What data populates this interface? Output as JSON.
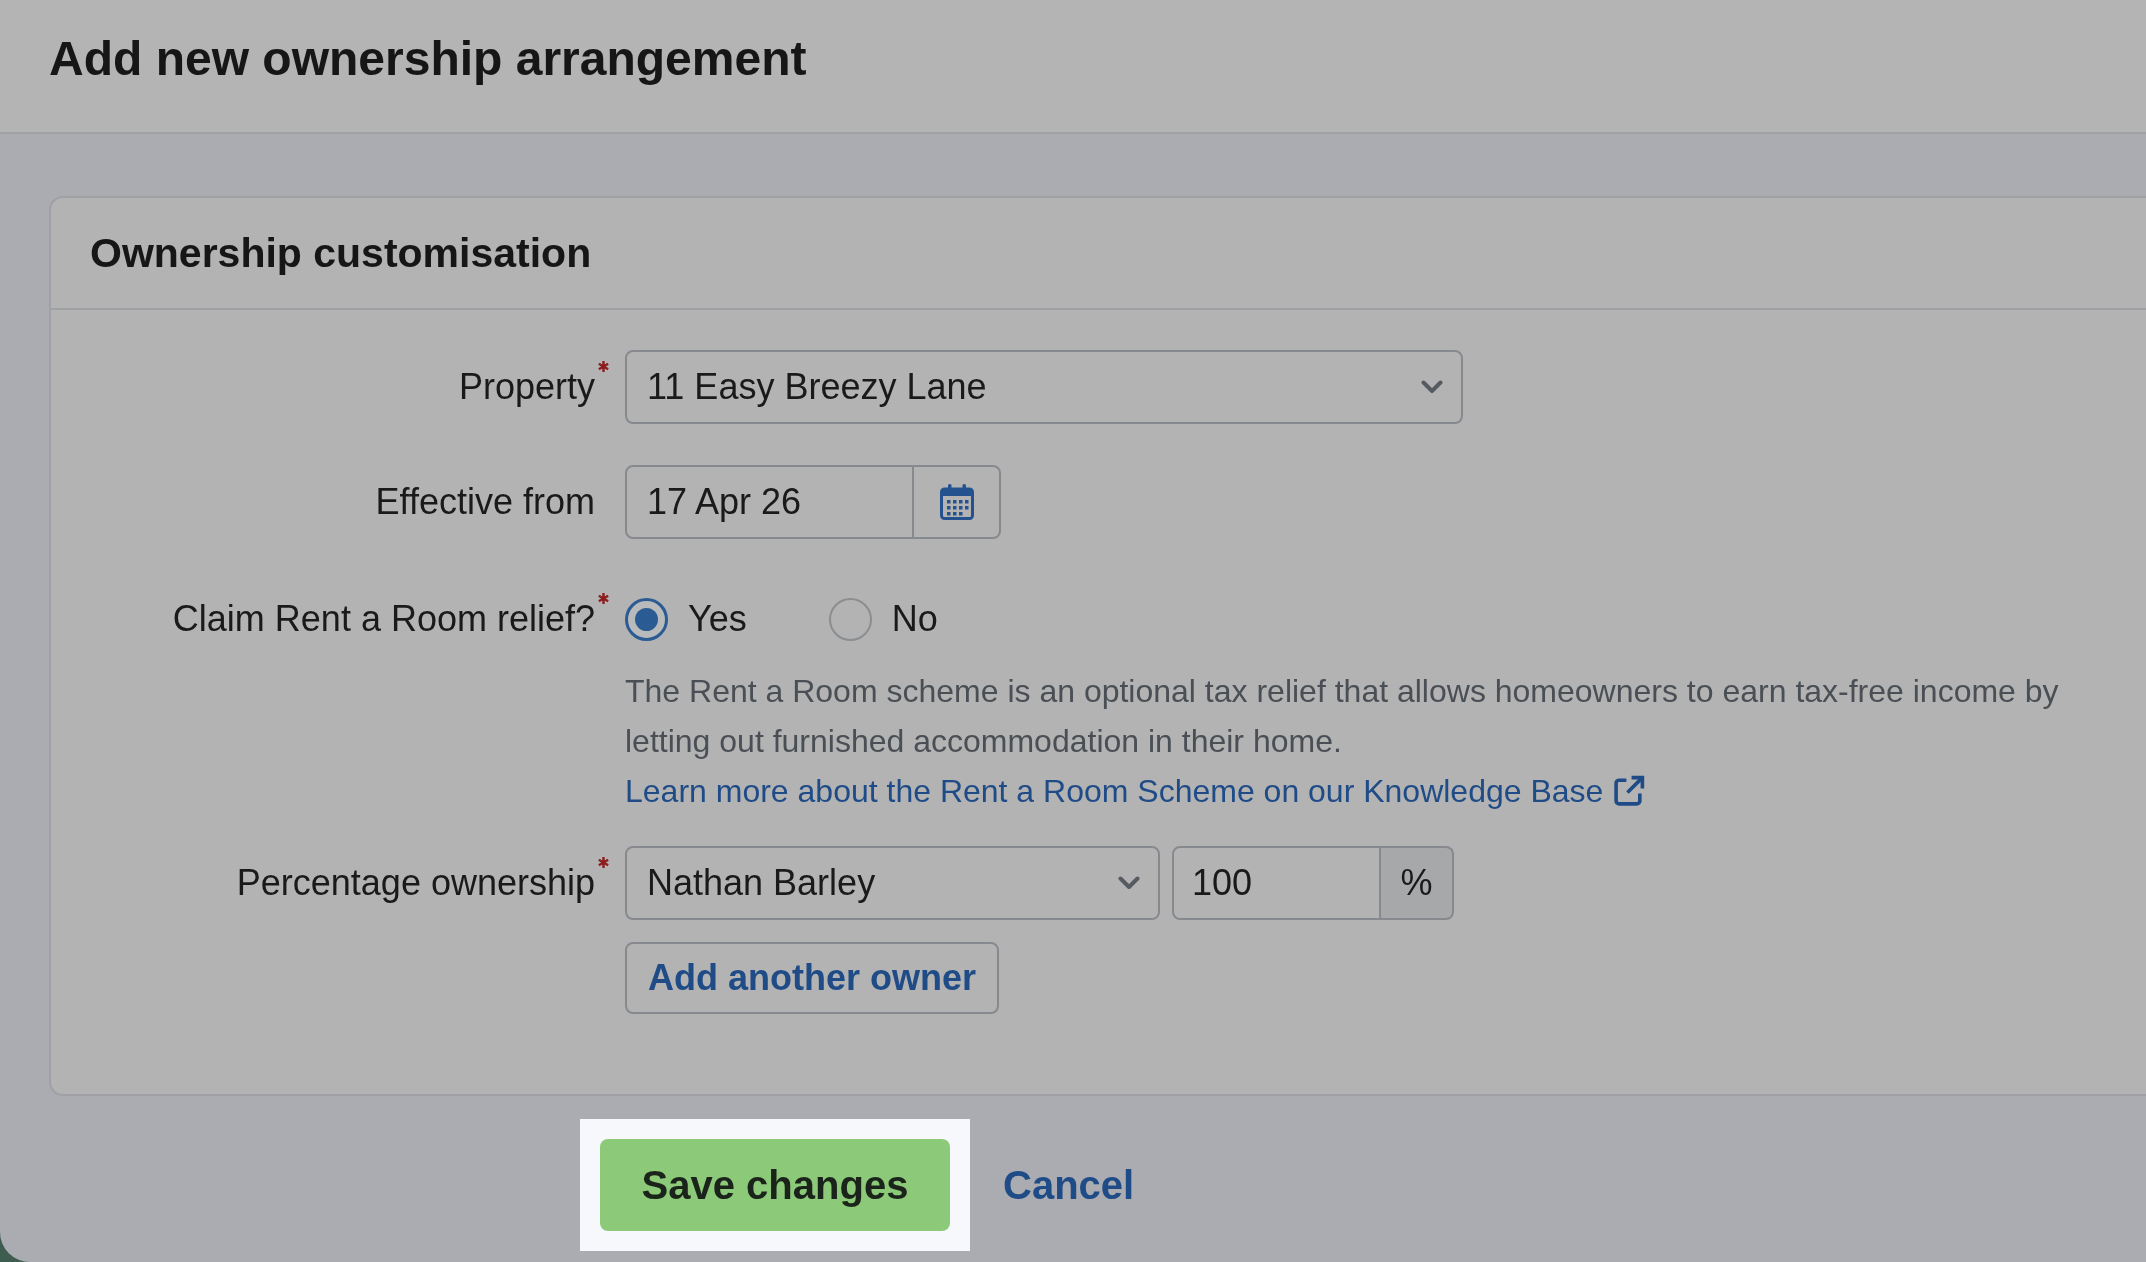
{
  "header": {
    "title": "Add new ownership arrangement"
  },
  "card": {
    "title": "Ownership customisation",
    "fields": [
      {
        "kind": "select",
        "label": "Property",
        "required": true,
        "value": "11 Easy Breezy Lane"
      },
      {
        "kind": "date",
        "label": "Effective from",
        "required": false,
        "value": "17 Apr 26"
      },
      {
        "kind": "radio",
        "label": "Claim Rent a Room relief?",
        "required": true,
        "options": [
          {
            "label": "Yes",
            "selected": true
          },
          {
            "label": "No",
            "selected": false
          }
        ],
        "help": {
          "text": "The Rent a Room scheme is an optional tax relief that allows homeowners to earn tax-free income by letting out furnished accommodation in their home.",
          "link": "Learn more about the Rent a Room Scheme on our Knowledge Base"
        }
      },
      {
        "kind": "ownership",
        "label": "Percentage ownership",
        "required": true,
        "owner": "Nathan Barley",
        "percent": "100",
        "unit": "%",
        "add_button": "Add another owner"
      }
    ]
  },
  "actions": {
    "save": "Save changes",
    "cancel": "Cancel"
  }
}
